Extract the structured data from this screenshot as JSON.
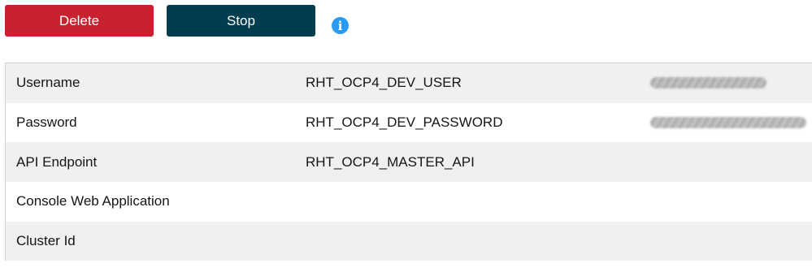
{
  "toolbar": {
    "delete_label": "Delete",
    "stop_label": "Stop",
    "info_glyph": "i"
  },
  "colors": {
    "delete_button": "#c9212f",
    "stop_button": "#003e4f",
    "info_icon": "#2b9af3",
    "alt_row": "#f0f0f0"
  },
  "rows": [
    {
      "label": "Username",
      "variable": "RHT_OCP4_DEV_USER",
      "value_obscured": true
    },
    {
      "label": "Password",
      "variable": "RHT_OCP4_DEV_PASSWORD",
      "value_obscured": true
    },
    {
      "label": "API Endpoint",
      "variable": "RHT_OCP4_MASTER_API",
      "value_obscured": false
    },
    {
      "label": "Console Web Application",
      "variable": "",
      "value_obscured": false
    },
    {
      "label": "Cluster Id",
      "variable": "",
      "value_obscured": false
    }
  ]
}
